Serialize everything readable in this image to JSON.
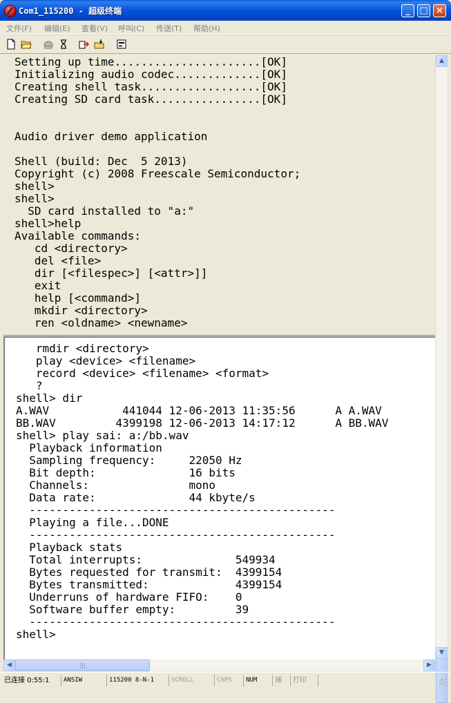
{
  "window": {
    "title": "Com1_115200 - 超级终端",
    "min": "_",
    "max": "□",
    "close": "×"
  },
  "menu": [
    "文件(F)",
    "编辑(E)",
    "查看(V)",
    "呼叫(C)",
    "传送(T)",
    "帮助(H)"
  ],
  "toolbar": [
    "new-icon",
    "open-icon",
    "phone-icon",
    "disconnect-icon",
    "send-icon",
    "receive-icon",
    "properties-icon"
  ],
  "terminal_top": [
    "Setting up time......................[OK]",
    "Initializing audio codec.............[OK]",
    "Creating shell task..................[OK]",
    "Creating SD card task................[OK]",
    "",
    "",
    "Audio driver demo application",
    "",
    "Shell (build: Dec  5 2013)",
    "Copyright (c) 2008 Freescale Semiconductor;",
    "shell>",
    "shell>",
    "  SD card installed to \"a:\"",
    "shell>help",
    "Available commands:",
    "   cd <directory>",
    "   del <file>",
    "   dir [<filespec>] [<attr>]]",
    "   exit",
    "   help [<command>]",
    "   mkdir <directory>",
    "   ren <oldname> <newname>"
  ],
  "terminal_bottom": [
    "   rmdir <directory>",
    "   play <device> <filename>",
    "   record <device> <filename> <format>",
    "   ?",
    "shell> dir",
    "A.WAV           441044 12-06-2013 11:35:56      A A.WAV",
    "BB.WAV         4399198 12-06-2013 14:17:12      A BB.WAV",
    "shell> play sai: a:/bb.wav",
    "  Playback information",
    "  Sampling frequency:     22050 Hz",
    "  Bit depth:              16 bits",
    "  Channels:               mono",
    "  Data rate:              44 kbyte/s",
    "  ----------------------------------------------",
    "  Playing a file...DONE",
    "  ----------------------------------------------",
    "  Playback stats",
    "  Total interrupts:              549934",
    "  Bytes requested for transmit:  4399154",
    "  Bytes transmitted:             4399154",
    "  Underruns of hardware FIFO:    0",
    "  Software buffer empty:         39",
    "  ----------------------------------------------",
    "shell>"
  ],
  "status": {
    "connection": "已连接 0:55:1",
    "emulation": "ANSIW",
    "settings": "115200 8-N-1",
    "scroll": "SCROLL",
    "caps": "CAPS",
    "num": "NUM",
    "capture": "捕",
    "print": "打印"
  },
  "colors": {
    "titlebar": "#0653d8",
    "chrome": "#ece9d8",
    "terminal_bg": "#ffffff",
    "text": "#000000"
  }
}
